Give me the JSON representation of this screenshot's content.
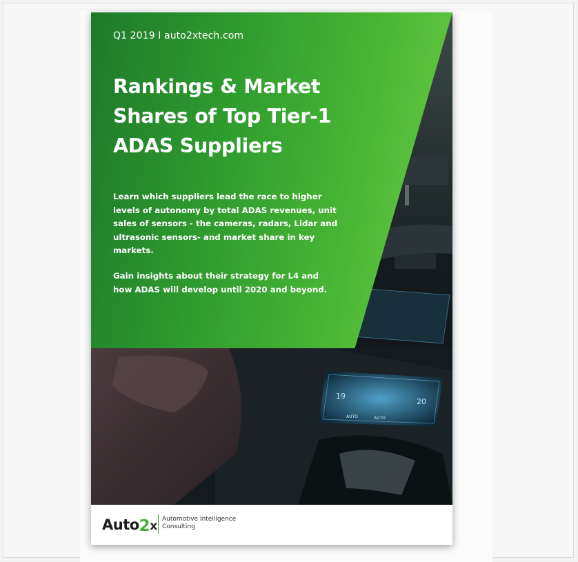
{
  "cover": {
    "top_line": "Q1 2019 I auto2xtech.com",
    "title_lines": [
      "Rankings & Market",
      "Shares of Top Tier-1",
      "ADAS Suppliers"
    ],
    "description_lines": [
      "Learn which suppliers lead the race  to higher",
      "levels of autonomy by total ADAS revenues, unit",
      "sales of sensors - the cameras, radars, Lidar and",
      "ultrasonic sensors- and market share in key",
      "markets."
    ],
    "insight_lines": [
      "Gain insights about their strategy for L4 and",
      "how ADAS will develop until 2020 and beyond."
    ],
    "green_color": "#45b234"
  },
  "footer": {
    "logo_text_a": "Auto",
    "logo_text_2": "2",
    "logo_text_x": "x",
    "tagline_lines": [
      "Automotive Intelligence",
      "Consulting"
    ],
    "accent_color": "#48ad36"
  },
  "photo_readouts": {
    "left_temp": "19",
    "right_temp": "20",
    "auto_labels": [
      "AUTO",
      "AUTO"
    ]
  }
}
